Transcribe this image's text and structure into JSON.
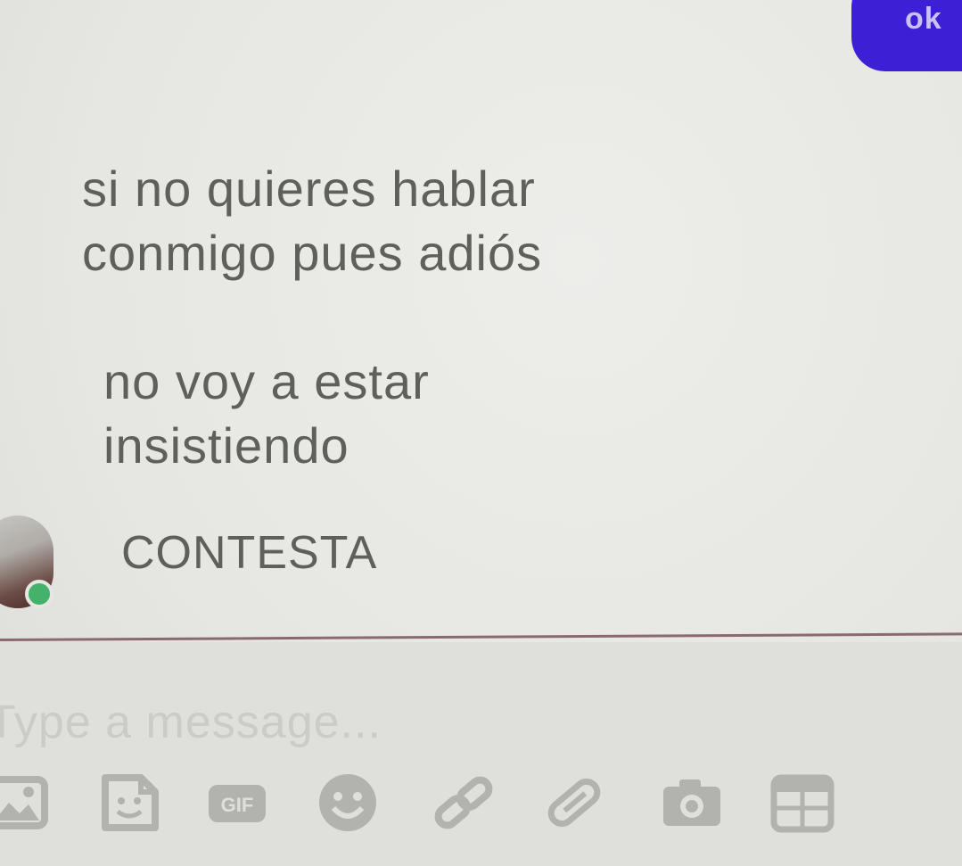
{
  "sent_bubble": {
    "text": "ok"
  },
  "messages": [
    {
      "lines": [
        "si no quieres hablar",
        "conmigo pues adiós"
      ]
    },
    {
      "lines": [
        "no voy a estar",
        "insistiendo"
      ]
    },
    {
      "lines": [
        "CONTESTA"
      ]
    }
  ],
  "composer": {
    "placeholder": "Type a message..."
  },
  "toolbar": {
    "icons": [
      "image-icon",
      "sticker-icon",
      "gif-icon",
      "emoji-icon",
      "link-icon",
      "attachment-icon",
      "camera-icon",
      "calendar-icon"
    ],
    "gif_label": "GIF"
  },
  "colors": {
    "accent": "#3d1fd6",
    "online": "#43b26a",
    "text": "#5f5f5c"
  }
}
